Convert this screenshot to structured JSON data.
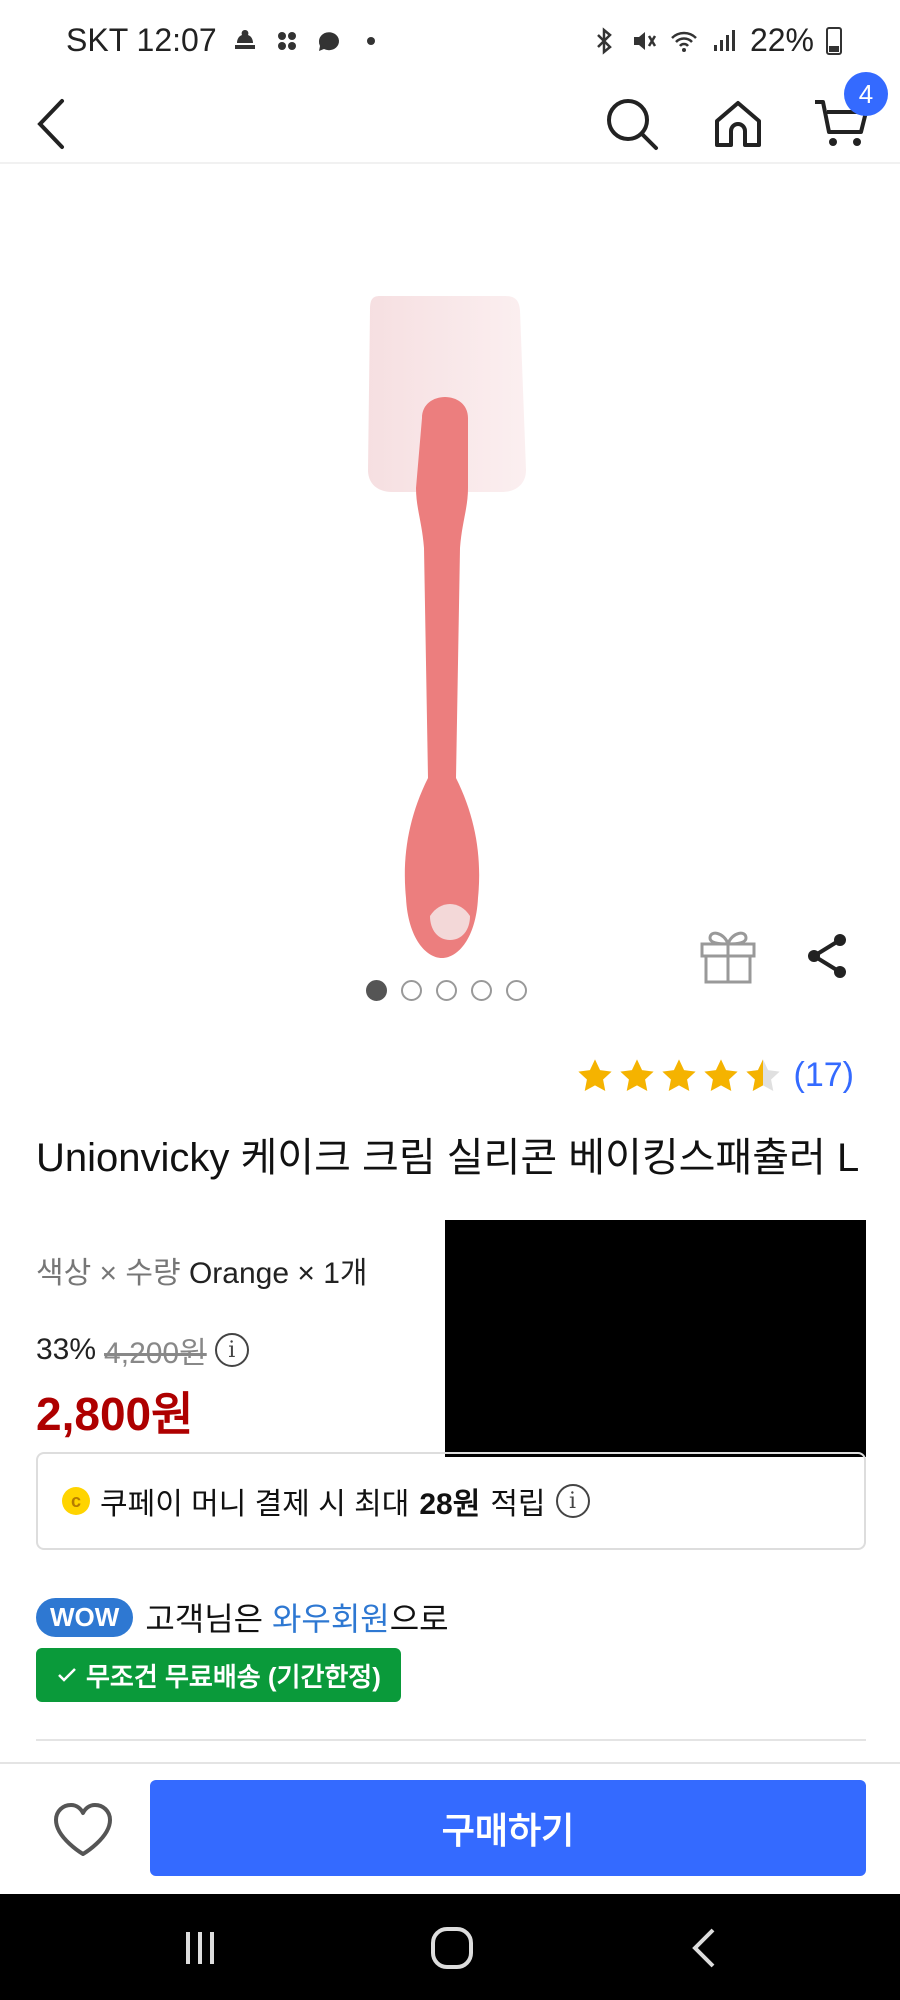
{
  "status_bar": {
    "carrier_time": "SKT 12:07",
    "battery": "22%"
  },
  "header": {
    "cart_count": "4",
    "icons": [
      "back-icon",
      "search-icon",
      "home-icon",
      "cart-icon"
    ]
  },
  "gallery": {
    "image_count": 5,
    "active_index": 0
  },
  "rating": {
    "stars": 4.5,
    "count": "(17)",
    "star_color": "#f5b300"
  },
  "product": {
    "title": "Unionvicky 케이크 크림 실리콘 베이킹스패츌러 L",
    "option_label": "색상 × 수량",
    "option_value": "Orange × 1개",
    "discount_rate": "33%",
    "original_price": "4,200원",
    "sale_price": "2,800원"
  },
  "coupay": {
    "coin_symbol": "c",
    "text_before": "쿠페이 머니 결제 시 최대",
    "amount": "28원",
    "text_after": "적립"
  },
  "wow": {
    "badge": "WOW",
    "text_before": "고객님은",
    "link": "와우회원",
    "text_after": "으로"
  },
  "shipping": {
    "label": "무조건 무료배송 (기간한정)"
  },
  "buy_bar": {
    "buy_label": "구매하기"
  },
  "colors": {
    "accent": "#346aff",
    "price_red": "#ae0000",
    "wow_blue": "#2e78d2",
    "shipping_green": "#0a9a3a"
  }
}
